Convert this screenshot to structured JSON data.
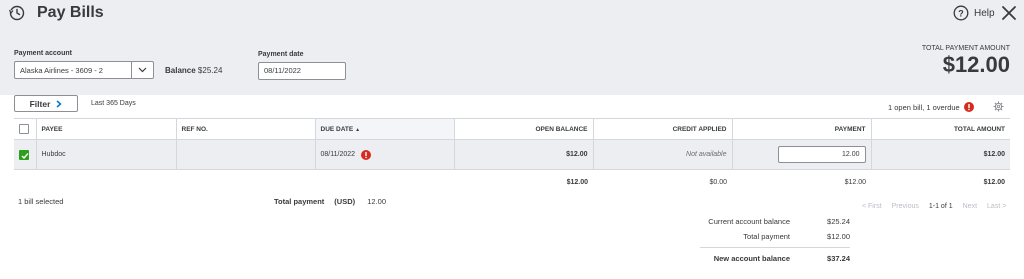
{
  "header": {
    "title": "Pay Bills",
    "help_label": "Help",
    "payment_account_label": "Payment account",
    "payment_account_value": "Alaska Airlines - 3609 - 2",
    "balance_label": "Balance",
    "balance_value": "$25.24",
    "payment_date_label": "Payment date",
    "payment_date_value": "08/11/2022",
    "total_payment_label": "TOTAL PAYMENT AMOUNT",
    "total_payment_value": "$12.00"
  },
  "toolbar": {
    "filter_label": "Filter",
    "range_label": "Last 365 Days",
    "status_text": "1 open bill, 1 overdue"
  },
  "table": {
    "columns": [
      "PAYEE",
      "REF NO.",
      "DUE DATE",
      "OPEN BALANCE",
      "CREDIT APPLIED",
      "PAYMENT",
      "TOTAL AMOUNT"
    ],
    "sort_indicator": "▲",
    "rows": [
      {
        "payee": "Hubdoc",
        "ref_no": "",
        "due_date": "08/11/2022",
        "open_balance": "$12.00",
        "credit_applied": "Not available",
        "payment": "12.00",
        "total_amount": "$12.00",
        "checked": true
      }
    ],
    "totals": {
      "open_balance": "$12.00",
      "credit_applied": "$0.00",
      "payment": "$12.00",
      "total_amount": "$12.00"
    }
  },
  "footer": {
    "selected_text": "1 bill selected",
    "total_payment_label": "Total payment",
    "total_payment_currency": "(USD)",
    "total_payment_value": "12.00",
    "pager": {
      "first": "< First",
      "previous": "Previous",
      "range": "1-1 of 1",
      "next": "Next",
      "last": "Last >"
    },
    "summary": {
      "current_label": "Current account balance",
      "current_value": "$25.24",
      "total_label": "Total payment",
      "total_value": "$12.00",
      "new_label": "New account balance",
      "new_value": "$37.24"
    }
  },
  "colors": {
    "header_bg": "#eceef1",
    "check_green": "#2ca01c",
    "alert_red": "#d52b1e"
  },
  "icons": [
    "history-icon",
    "help-icon",
    "close-icon",
    "chevron-down-icon",
    "chevron-right-icon",
    "alert-icon",
    "gear-icon",
    "checkmark-icon"
  ]
}
